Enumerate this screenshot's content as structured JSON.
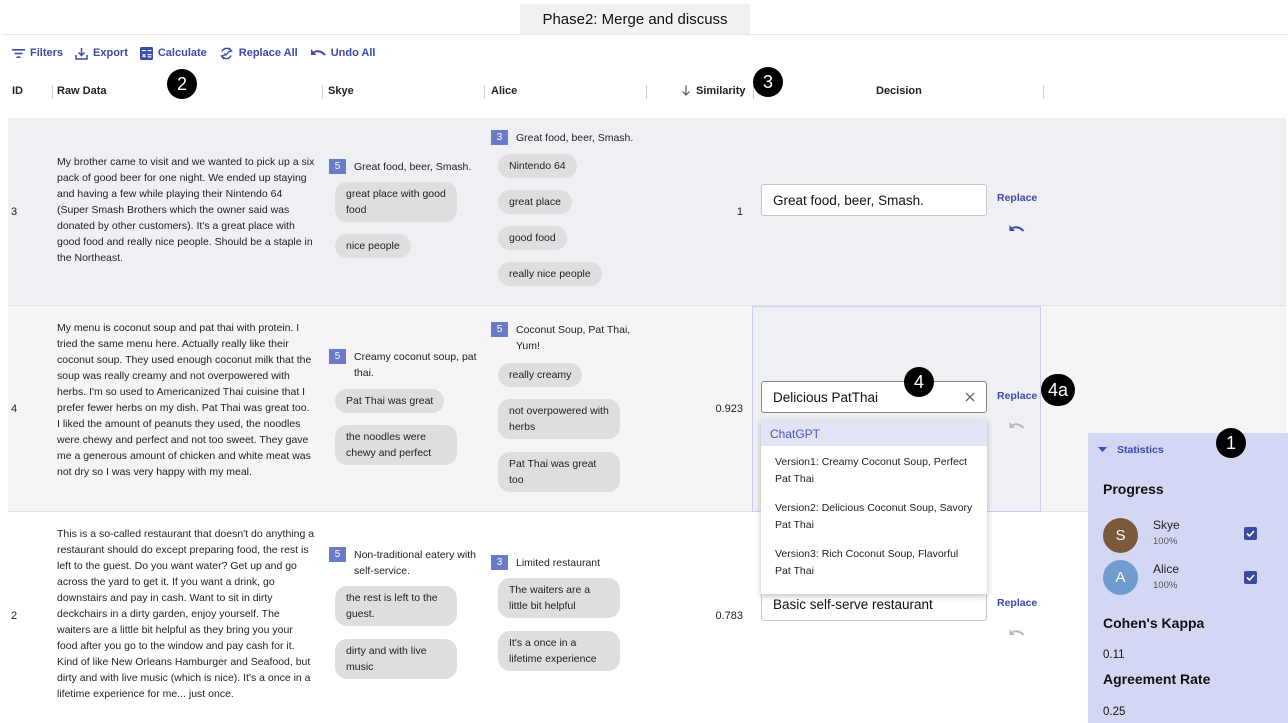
{
  "phase_label": "Phase2: Merge and discuss",
  "toolbar": {
    "filters": "Filters",
    "export": "Export",
    "calculate": "Calculate",
    "replace_all": "Replace All",
    "undo_all": "Undo All"
  },
  "columns": {
    "id": "ID",
    "raw": "Raw Data",
    "skye": "Skye",
    "alice": "Alice",
    "similarity": "Similarity",
    "decision": "Decision"
  },
  "rows": [
    {
      "id": "3",
      "raw": "My brother came to visit and we wanted to pick up a six pack of good beer for one night. We ended up staying and having a few while playing their Nintendo 64 (Super Smash Brothers which the owner said was donated by other customers). It's a great place with good food and really nice people. Should be a staple in the Northeast.",
      "skye_count": "5",
      "skye_label": "Great food, beer, Smash.",
      "skye_chips": [
        "great place with good food",
        "nice people"
      ],
      "alice_count": "3",
      "alice_label": "Great food, beer, Smash.",
      "alice_chips": [
        "Nintendo 64",
        "great place",
        "good food",
        "really nice people"
      ],
      "similarity": "1",
      "decision": "Great food, beer, Smash."
    },
    {
      "id": "4",
      "raw": "My menu is coconut soup and pat thai with protein. I tried the same menu here. Actually really like their coconut soup. They used enough coconut milk that the soup was really creamy and not overpowered with herbs. I'm so used to Americanized Thai cuisine that I prefer fewer herbs on my dish. Pat Thai was great too. I liked the amount of peanuts they used, the noodles were chewy and perfect and not too sweet. They gave me a generous amount of chicken and white meat was not dry so I was very happy with my meal.",
      "skye_count": "5",
      "skye_label": "Creamy coconut soup, pat thai.",
      "skye_chips": [
        "Pat Thai was great",
        "the noodles were chewy and perfect"
      ],
      "alice_count": "5",
      "alice_label": "Coconut Soup, Pat Thai, Yum!",
      "alice_chips": [
        "really creamy",
        "not overpowered with herbs",
        "Pat Thai was great too"
      ],
      "similarity": "0.923",
      "decision": "Delicious PatThai"
    },
    {
      "id": "2",
      "raw": "This is a so-called restaurant that doesn't do anything a restaurant should do except preparing food, the rest is left to the guest. Do you want water? Get up and go across the yard to get it. If you want a drink, go downstairs and pay in cash. Want to sit in dirty deckchairs in a dirty garden, enjoy yourself. The waiters are a little bit helpful as they bring you your food after you go to the window and pay cash for it. Kind of like New Orleans Hamburger and Seafood, but dirty and with live music (which is nice). It's a once in a lifetime experience for me... just once.",
      "skye_count": "5",
      "skye_label": "Non-traditional eatery with self-service.",
      "skye_chips": [
        "the rest is left to the guest.",
        "dirty and with live music"
      ],
      "alice_count": "3",
      "alice_label": "Limited restaurant",
      "alice_chips": [
        "The waiters are a little bit helpful",
        "It's a once in a lifetime experience"
      ],
      "similarity": "0.783",
      "decision": "Basic self-serve restaurant"
    }
  ],
  "replace_label": "Replace",
  "dropdown": {
    "header": "ChatGPT",
    "items": [
      "Version1: Creamy Coconut Soup, Perfect Pat Thai",
      "Version2: Delicious Coconut Soup, Savory Pat Thai",
      "Version3: Rich Coconut Soup, Flavorful Pat Thai"
    ]
  },
  "markers": {
    "m1": "1",
    "m2": "2",
    "m3": "3",
    "m4": "4",
    "m4a": "4a"
  },
  "stats": {
    "header": "Statistics",
    "progress_title": "Progress",
    "users": [
      {
        "initial": "S",
        "name": "Skye",
        "pct": "100%",
        "color": "#7a5a3a"
      },
      {
        "initial": "A",
        "name": "Alice",
        "pct": "100%",
        "color": "#6f9ccc"
      }
    ],
    "kappa_title": "Cohen's Kappa",
    "kappa_value": "0.11",
    "agreement_title": "Agreement Rate",
    "agreement_value": "0.25"
  },
  "colors": {
    "accent": "#3a4ba8",
    "badge": "#6b7bc9",
    "stats_bg": "#d3d7f4"
  }
}
